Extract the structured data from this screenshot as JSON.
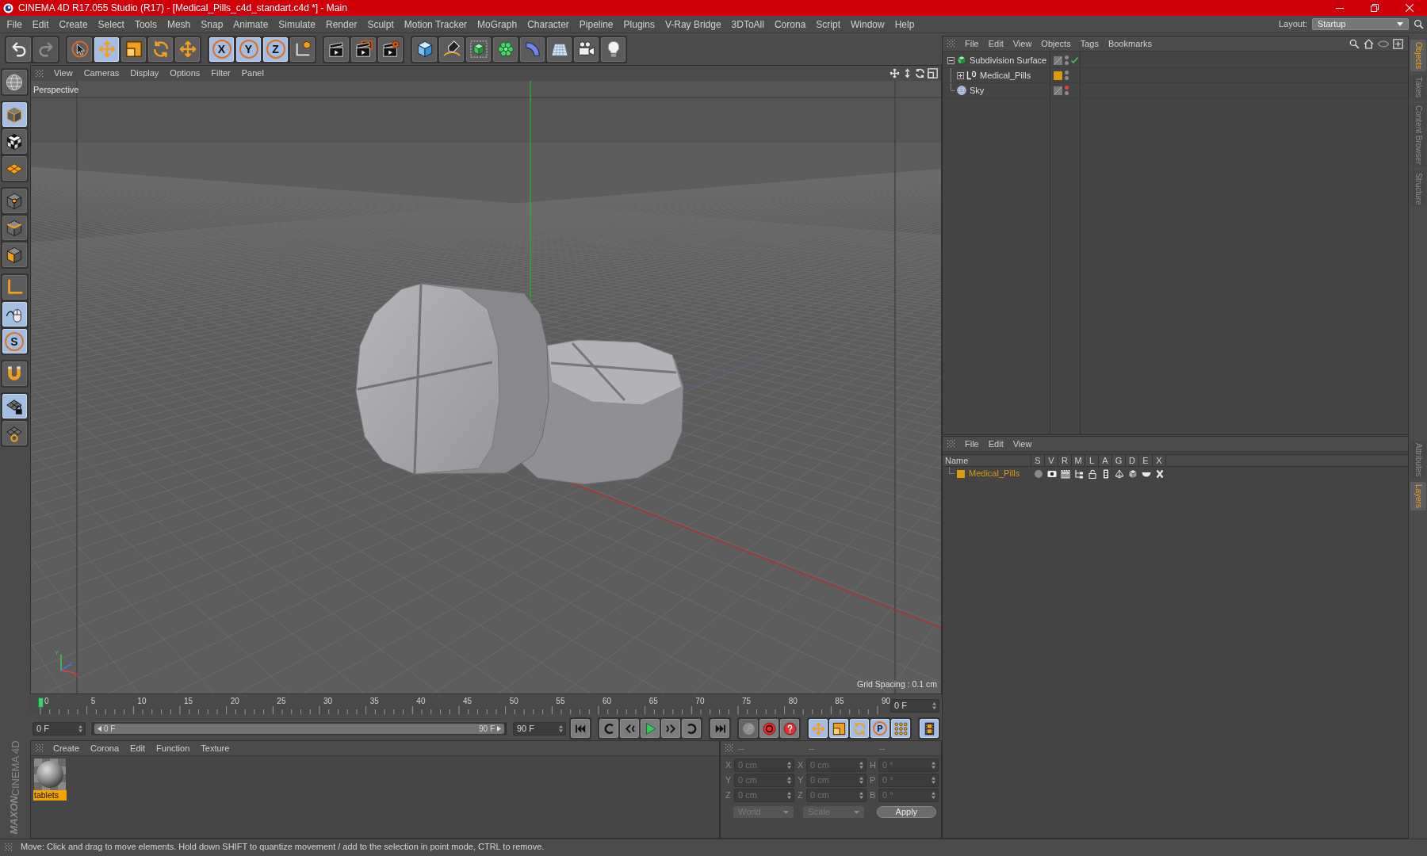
{
  "window": {
    "title": "CINEMA 4D R17.055 Studio (R17) - [Medical_Pills_c4d_standart.c4d *] - Main"
  },
  "menu_bar": {
    "items": [
      "File",
      "Edit",
      "Create",
      "Select",
      "Tools",
      "Mesh",
      "Snap",
      "Animate",
      "Simulate",
      "Render",
      "Sculpt",
      "Motion Tracker",
      "MoGraph",
      "Character",
      "Pipeline",
      "Plugins",
      "V-Ray Bridge",
      "3DToAll",
      "Corona",
      "Script",
      "Window",
      "Help"
    ],
    "layout_label": "Layout:",
    "layout_value": "Startup"
  },
  "toolbar": {
    "groups": [
      [
        {
          "kind": "undo",
          "disabled": false
        },
        {
          "kind": "redo",
          "disabled": true
        }
      ],
      [
        {
          "kind": "select",
          "selected": false
        },
        {
          "kind": "move",
          "selected": true
        },
        {
          "kind": "scale",
          "selected": false
        },
        {
          "kind": "rotate",
          "selected": false
        },
        {
          "kind": "recent",
          "selected": false
        }
      ],
      [
        {
          "kind": "axis",
          "label": "X",
          "selected": true
        },
        {
          "kind": "axis",
          "label": "Y",
          "selected": true
        },
        {
          "kind": "axis",
          "label": "Z",
          "selected": true
        },
        {
          "kind": "coords",
          "selected": false
        }
      ],
      [
        {
          "kind": "renderview"
        },
        {
          "kind": "renderpicture"
        },
        {
          "kind": "rendersettings"
        }
      ],
      [
        {
          "kind": "cube"
        },
        {
          "kind": "pen"
        },
        {
          "kind": "subdivision"
        },
        {
          "kind": "cloner"
        },
        {
          "kind": "deformer"
        },
        {
          "kind": "floor"
        },
        {
          "kind": "camera"
        },
        {
          "kind": "light"
        }
      ]
    ]
  },
  "left_toolbar": {
    "groups": [
      [
        {
          "kind": "editable",
          "selected": false
        }
      ],
      [
        {
          "kind": "model",
          "selected": true
        },
        {
          "kind": "texture",
          "selected": false
        },
        {
          "kind": "workplane",
          "selected": false
        }
      ],
      [
        {
          "kind": "points",
          "selected": false
        },
        {
          "kind": "edges",
          "selected": false
        },
        {
          "kind": "polygons",
          "selected": false
        }
      ],
      [
        {
          "kind": "axismode",
          "selected": false
        },
        {
          "kind": "tweak",
          "selected": true
        },
        {
          "kind": "solo",
          "label": "S",
          "selected": true
        }
      ],
      [
        {
          "kind": "snap",
          "selected": false
        }
      ],
      [
        {
          "kind": "lockplane",
          "selected": true
        },
        {
          "kind": "planar",
          "selected": false
        }
      ]
    ],
    "logo": {
      "brand": "MAXON",
      "product": "CINEMA 4D"
    }
  },
  "viewport": {
    "menu": [
      "View",
      "Cameras",
      "Display",
      "Options",
      "Filter",
      "Panel"
    ],
    "camera": "Perspective",
    "grid_spacing": "Grid Spacing : 0.1 cm",
    "gizmo_labels": [
      "Y",
      "X",
      "Z"
    ]
  },
  "timeline": {
    "ticks": [
      "0",
      "5",
      "10",
      "15",
      "20",
      "25",
      "30",
      "35",
      "40",
      "45",
      "50",
      "55",
      "60",
      "65",
      "70",
      "75",
      "80",
      "85",
      "90"
    ],
    "playhead": {
      "level": 0
    },
    "frame_field": "0 F"
  },
  "transport": {
    "start_field": "0 F",
    "range_slider": {
      "level": 1
    },
    "range_start": "0 F",
    "range_end": "90 F",
    "end_field": "90 F",
    "groups": [
      [
        {
          "kind": "start"
        }
      ],
      [
        {
          "kind": "prevkey"
        },
        {
          "kind": "stepback"
        },
        {
          "kind": "play"
        },
        {
          "kind": "stepforward"
        },
        {
          "kind": "nextkey"
        }
      ],
      [
        {
          "kind": "end"
        }
      ],
      [
        {
          "kind": "record",
          "disabled": true
        },
        {
          "kind": "autokey",
          "disabled": false
        },
        {
          "kind": "keyselection",
          "disabled": false
        }
      ],
      [
        {
          "kind": "position",
          "selected": true
        },
        {
          "kind": "scale",
          "selected": true
        },
        {
          "kind": "rotation",
          "selected": true
        },
        {
          "kind": "parameter",
          "label": "P",
          "selected": true
        },
        {
          "kind": "pointlevel",
          "selected": true
        }
      ],
      [
        {
          "kind": "timeline",
          "selected": true
        }
      ]
    ]
  },
  "materials": {
    "menu": [
      "Create",
      "Corona",
      "Edit",
      "Function",
      "Texture"
    ],
    "items": [
      {
        "name": "tablets",
        "selected": true
      }
    ]
  },
  "coordinates": {
    "headers": [
      "--",
      "--",
      "--"
    ],
    "disabled": true,
    "rows": [
      {
        "fields": [
          {
            "label": "X",
            "value": "0 cm"
          },
          {
            "label": "X",
            "value": "0 cm"
          },
          {
            "label": "H",
            "value": "0 °"
          }
        ]
      },
      {
        "fields": [
          {
            "label": "Y",
            "value": "0 cm"
          },
          {
            "label": "Y",
            "value": "0 cm"
          },
          {
            "label": "P",
            "value": "0 °"
          }
        ]
      },
      {
        "fields": [
          {
            "label": "Z",
            "value": "0 cm"
          },
          {
            "label": "Z",
            "value": "0 cm"
          },
          {
            "label": "B",
            "value": "0 °"
          }
        ]
      }
    ],
    "dropdowns": [
      "World",
      "Scale"
    ],
    "apply": "Apply"
  },
  "object_manager": {
    "menu": [
      "File",
      "Edit",
      "View",
      "Objects",
      "Tags",
      "Bookmarks"
    ],
    "objects": [
      {
        "name": "Subdivision Surface",
        "kind": "subdivision",
        "expanded": true,
        "hidden_in_editor": false,
        "hidden_in_render": false,
        "enabled": true,
        "children": [
          {
            "name": "Medical_Pills",
            "kind": "null",
            "expanded": false,
            "color": "#d99a0c",
            "hidden_in_editor": false,
            "hidden_in_render": false
          }
        ]
      },
      {
        "name": "Sky",
        "kind": "sky",
        "hidden_in_editor": true,
        "hidden_in_render": false
      }
    ]
  },
  "layer_manager": {
    "menu": [
      "File",
      "Edit",
      "View"
    ],
    "columns": [
      "Name",
      "S",
      "V",
      "R",
      "M",
      "L",
      "A",
      "G",
      "D",
      "E",
      "X"
    ],
    "layers": [
      {
        "name": "Medical_Pills",
        "color": "#d99a0c",
        "solo": false
      }
    ]
  },
  "side_tabs": {
    "top": [
      {
        "label": "Objects",
        "selected": true
      },
      {
        "label": "Takes",
        "selected": false
      },
      {
        "label": "Content Browser",
        "selected": false
      },
      {
        "label": "Structure",
        "selected": false
      }
    ],
    "bottom": [
      {
        "label": "Attributes",
        "selected": false
      },
      {
        "label": "Layers",
        "selected": true
      }
    ]
  },
  "status_bar": {
    "text": "Move: Click and drag to move elements. Hold down SHIFT to quantize movement / add to the selection in point mode, CTRL to remove."
  }
}
